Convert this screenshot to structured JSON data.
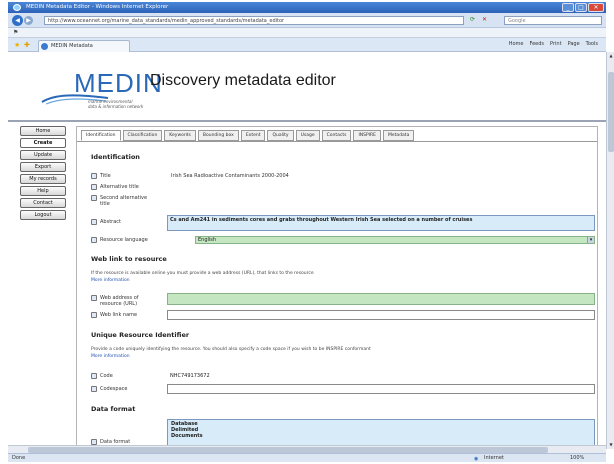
{
  "browser": {
    "window_title": "MEDIN Metadata Editor - Windows Internet Explorer",
    "address": "http://www.oceannet.org/marine_data_standards/medin_approved_standards/metadata_editor",
    "search_placeholder": "Google",
    "tab_title": "MEDIN Metadata",
    "command_items": [
      "Home",
      "Feeds",
      "Print",
      "Page",
      "Tools"
    ],
    "window_buttons": [
      "_",
      "□",
      "✕"
    ]
  },
  "header": {
    "logo_word": "MEDIN",
    "tagline_1": "marine environmental",
    "tagline_2": "data & information network",
    "app_title": "Discovery metadata editor"
  },
  "leftnav": {
    "items": [
      {
        "label": "Home",
        "active": false
      },
      {
        "label": "Create",
        "active": true
      },
      {
        "label": "Update",
        "active": false
      },
      {
        "label": "Export",
        "active": false
      },
      {
        "label": "My records",
        "active": false
      },
      {
        "label": "Help",
        "active": false
      },
      {
        "label": "Contact",
        "active": false
      },
      {
        "label": "Logout",
        "active": false
      }
    ]
  },
  "tabs": [
    "Identification",
    "Classification",
    "Keywords",
    "Bounding box",
    "Extent",
    "Quality",
    "Usage",
    "Contacts",
    "INSPIRE",
    "Metadata"
  ],
  "identification": {
    "title": "Identification",
    "title_label": "Title",
    "title_value": "Irish Sea Radioactive Contaminants 2000-2004",
    "alt_title_label": "Alternative title",
    "alt_title_label_2": "Second alternative title",
    "abstract_label": "Abstract",
    "abstract_value": "Cs and Am241 in sediments cores and grabs throughout Western Irish Sea selected on a number of cruises",
    "language_label": "Resource language",
    "language_value": "English"
  },
  "weblink": {
    "title": "Web link to resource",
    "help": "If the resource is available online you must provide a web address (URL), that links to the resource",
    "more_info": "More information",
    "address_label": "Web address of resource (URL)",
    "name_label": "Web link name"
  },
  "identifier": {
    "title": "Unique Resource Identifier",
    "help": "Provide a code uniquely identifying the resource. You should also specify a code space if you wish to be INSPIRE conformant",
    "more_info": "More information",
    "code_label": "Code",
    "code_value": "NHC749173672",
    "codespace_label": "Codespace"
  },
  "dataformat": {
    "title": "Data format",
    "label": "Data format",
    "options": [
      "Database",
      "Delimited",
      "Documents"
    ]
  },
  "status": {
    "text": "Done",
    "zone": "Internet",
    "zoom": "100%"
  }
}
